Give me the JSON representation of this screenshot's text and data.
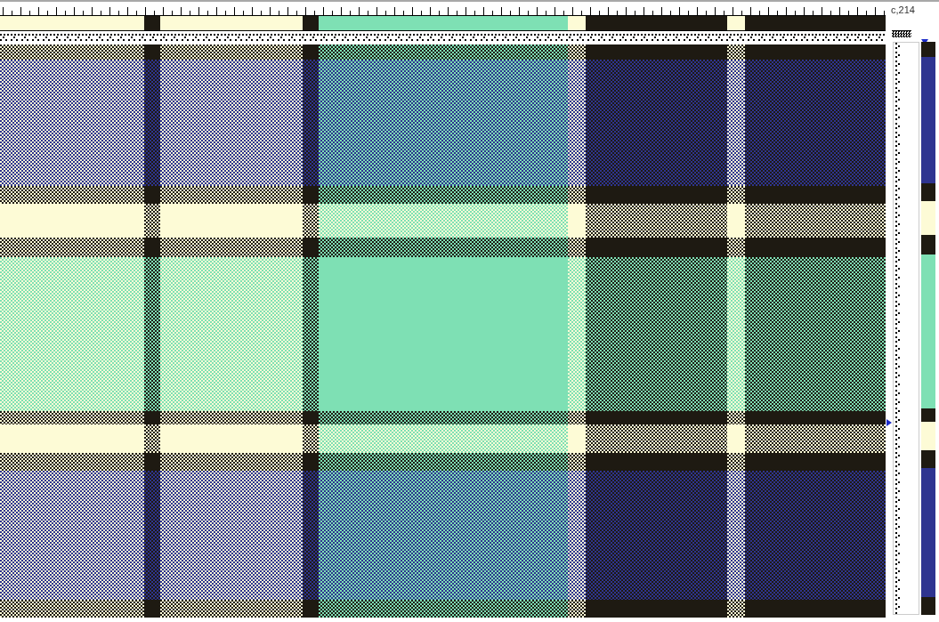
{
  "position_label": "c,214",
  "warp_stripes": [
    {
      "color": "#fdfbd6"
    },
    {
      "color": "#1e1a12"
    },
    {
      "color": "#fdfbd6"
    },
    {
      "color": "#1e1a12"
    },
    {
      "color": "#7ee0b4"
    },
    {
      "color": "#fdfbd6"
    },
    {
      "color": "#1e1a12"
    },
    {
      "color": "#fdfbd6"
    },
    {
      "color": "#1e1a12"
    }
  ],
  "weft_stripes": [
    {
      "color": "#1e1a12"
    },
    {
      "color": "#2e3490"
    },
    {
      "color": "#1e1a12"
    },
    {
      "color": "#fdfbd6"
    },
    {
      "color": "#1e1a12"
    },
    {
      "color": "#7ee0b4"
    },
    {
      "color": "#1e1a12"
    },
    {
      "color": "#fdfbd6"
    },
    {
      "color": "#1e1a12"
    },
    {
      "color": "#2e3490"
    },
    {
      "color": "#1e1a12"
    }
  ]
}
